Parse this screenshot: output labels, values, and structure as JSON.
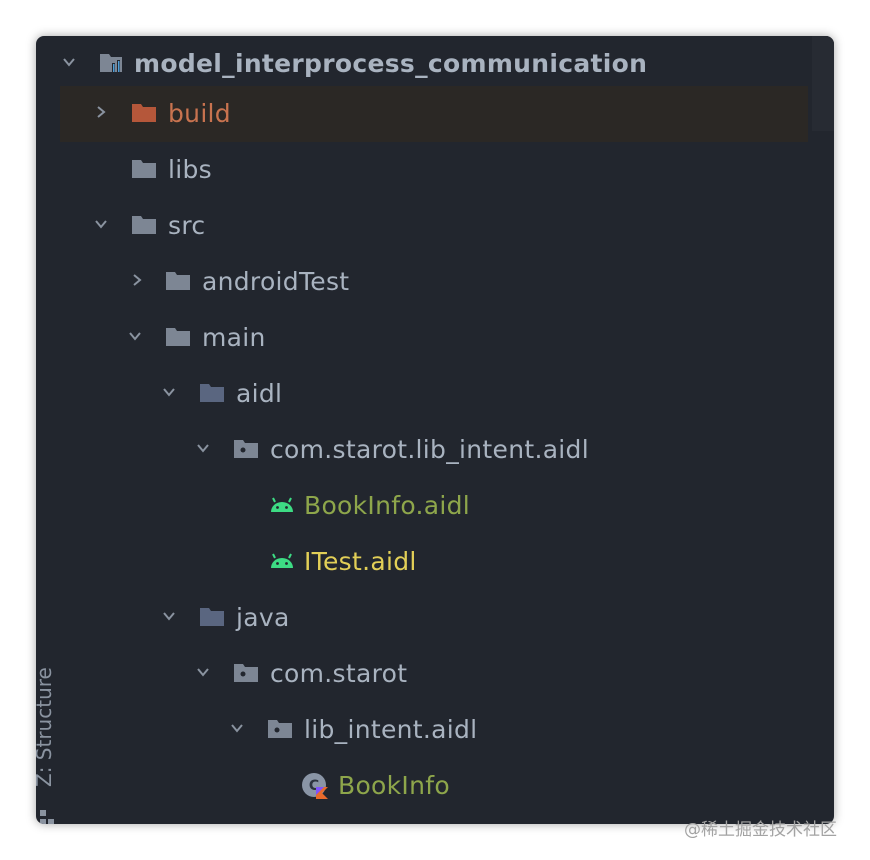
{
  "tree": {
    "items": [
      {
        "label": "model_interprocess_communication",
        "icon": "module-folder-icon",
        "expanded": true
      },
      {
        "label": "build",
        "icon": "folder-icon",
        "expanded": false
      },
      {
        "label": "libs",
        "icon": "folder-icon"
      },
      {
        "label": "src",
        "icon": "folder-icon",
        "expanded": true
      },
      {
        "label": "androidTest",
        "icon": "folder-icon",
        "expanded": false
      },
      {
        "label": "main",
        "icon": "folder-icon",
        "expanded": true
      },
      {
        "label": "aidl",
        "icon": "source-folder-icon",
        "expanded": true
      },
      {
        "label": "com.starot.lib_intent.aidl",
        "icon": "package-icon",
        "expanded": true
      },
      {
        "label": "BookInfo.aidl",
        "icon": "android-icon"
      },
      {
        "label": "ITest.aidl",
        "icon": "android-icon"
      },
      {
        "label": "java",
        "icon": "source-folder-icon",
        "expanded": true
      },
      {
        "label": "com.starot",
        "icon": "package-icon",
        "expanded": true
      },
      {
        "label": "lib_intent.aidl",
        "icon": "package-icon",
        "expanded": true
      },
      {
        "label": "BookInfo",
        "icon": "kotlin-class-icon"
      }
    ]
  },
  "side_tab": {
    "label": "Z: Structure",
    "icon": "structure-icon"
  },
  "colors": {
    "background": "#22262e",
    "text": "#a9b3c0",
    "excluded_folder": "#c8734f",
    "aidl_file": "#8ea64b",
    "modified_file": "#e2cf57",
    "android_green": "#3ddc84"
  },
  "watermark": "@稀土掘金技术社区"
}
